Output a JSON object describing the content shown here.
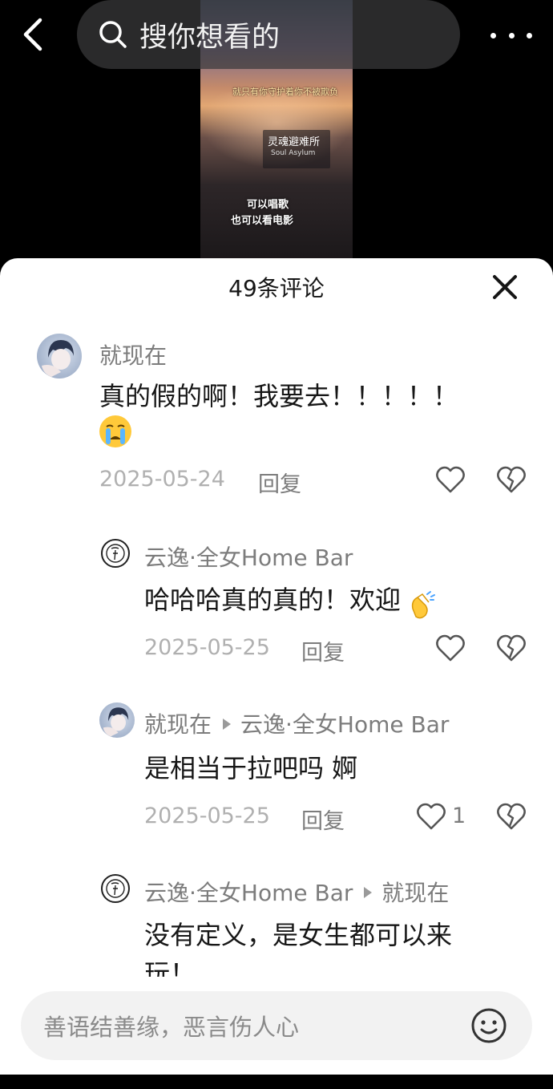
{
  "header": {
    "search_text": "搜你想看的"
  },
  "video": {
    "caption_top": "就只有你守护着你不被欺负",
    "sign_title": "灵魂避难所",
    "sign_sub": "Soul Asylum",
    "line1": "可以唱歌",
    "line2": "也可以看电影"
  },
  "sheet": {
    "title": "49条评论"
  },
  "comments": [
    {
      "author": "就现在",
      "text_line1": "真的假的啊！我要去！！！！！",
      "emoji": "crying-face-icon",
      "date": "2025-05-24",
      "reply_label": "回复"
    },
    {
      "author": "云逸·全女Home Bar",
      "text": "哈哈哈真的真的！欢迎",
      "emoji": "clapping-hands-icon",
      "date": "2025-05-25",
      "reply_label": "回复"
    },
    {
      "author": "就现在",
      "reply_to": "云逸·全女Home Bar",
      "text": "是相当于拉吧吗 婀",
      "date": "2025-05-25",
      "reply_label": "回复",
      "likes": "1"
    },
    {
      "author": "云逸·全女Home Bar",
      "reply_to": "就现在",
      "text_line1": "没有定义，是女生都可以来",
      "text_line2": "玩！"
    }
  ],
  "input": {
    "placeholder": "善语结善缘，恶言伤人心"
  },
  "colors": {
    "background": "#000000",
    "sheet": "#ffffff",
    "secondary_text": "#7c7c7c",
    "date_text": "#b0b0b0"
  }
}
